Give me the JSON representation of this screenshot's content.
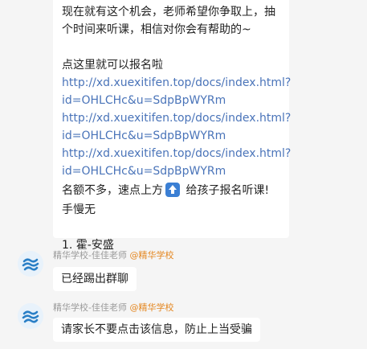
{
  "top_message": {
    "line1": "现在就有这个机会，老师希望你争取上，抽",
    "line2": "个时间来听课，相信对你会有帮助的~",
    "line3": "点这里就可以报名啦",
    "links": [
      {
        "a": "http://xd.xuexitifen.top/docs/index.html?",
        "b": "id=OHLCHc&u=SdpBpWYRm"
      },
      {
        "a": "http://xd.xuexitifen.top/docs/index.html?",
        "b": "id=OHLCHc&u=SdpBpWYRm"
      },
      {
        "a": "http://xd.xuexitifen.top/docs/index.html?",
        "b": "id=OHLCHc&u=SdpBpWYRm"
      }
    ],
    "cta_before": " 名额不多，速点上方",
    "cta_after": " 给孩子报名听课!",
    "line_slow": "手慢无",
    "list_item": "1. 霍-安盛"
  },
  "messages": [
    {
      "sender": "精华学校-佳佳老师",
      "tag": "@精华学校",
      "text": "已经踢出群聊"
    },
    {
      "sender": "精华学校-佳佳老师",
      "tag": "@精华学校",
      "text": "请家长不要点击该信息，防止上当受骗"
    }
  ],
  "colors": {
    "link": "#4a74b9",
    "tag": "#e4861f",
    "background": "#f5f5f5",
    "bubble": "#ffffff"
  },
  "icons": {
    "up_arrow": "up-arrow-icon",
    "avatar_logo": "jinghua-logo-icon"
  }
}
